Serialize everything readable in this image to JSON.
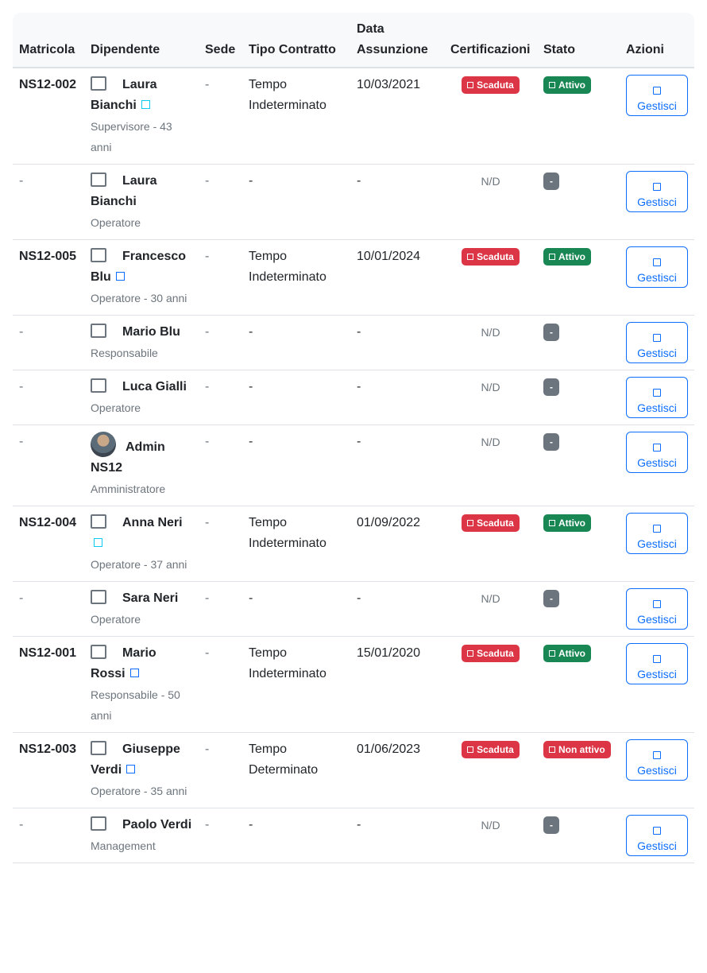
{
  "headers": {
    "matricola": "Matricola",
    "dipendente": "Dipendente",
    "sede": "Sede",
    "tipo_contratto": "Tipo Contratto",
    "data_assunzione": "Data Assunzione",
    "certificazioni": "Certificazioni",
    "stato": "Stato",
    "azioni": "Azioni"
  },
  "colors": {
    "danger": "#dc3545",
    "success": "#198754",
    "secondary": "#6c757d",
    "primary": "#0d6efd",
    "info": "#0dcaf0"
  },
  "rows": [
    {
      "matricola": "NS12-002",
      "first": "Laura",
      "last": "Bianchi",
      "mini": "info",
      "subtitle": "Supervisore - 43 anni",
      "sede": "-",
      "contratto": "Tempo Indeterminato",
      "data": "10/03/2021",
      "cert": "Scaduta",
      "stato": "Attivo",
      "stato_type": "success",
      "action": "Gestisci",
      "avatar": "checkbox-icon"
    },
    {
      "matricola": "-",
      "first": "Laura",
      "last": "Bianchi",
      "mini": "",
      "subtitle": "Operatore",
      "sede": "-",
      "contratto": "-",
      "data": "-",
      "cert": "N/D",
      "stato": "-",
      "stato_type": "secondary",
      "action": "Gestisci",
      "avatar": "checkbox-icon"
    },
    {
      "matricola": "NS12-005",
      "first": "Francesco",
      "last": "Blu",
      "mini": "blue",
      "subtitle": "Operatore - 30 anni",
      "sede": "-",
      "contratto": "Tempo Indeterminato",
      "data": "10/01/2024",
      "cert": "Scaduta",
      "stato": "Attivo",
      "stato_type": "success",
      "action": "Gestisci",
      "avatar": "checkbox-icon"
    },
    {
      "matricola": "-",
      "first": "Mario Blu",
      "last": "",
      "mini": "",
      "subtitle": "Responsabile",
      "sede": "-",
      "contratto": "-",
      "data": "-",
      "cert": "N/D",
      "stato": "-",
      "stato_type": "secondary",
      "action": "Gestisci",
      "avatar": "checkbox-icon"
    },
    {
      "matricola": "-",
      "first": "Luca Gialli",
      "last": "",
      "mini": "",
      "subtitle": "Operatore",
      "sede": "-",
      "contratto": "-",
      "data": "-",
      "cert": "N/D",
      "stato": "-",
      "stato_type": "secondary",
      "action": "Gestisci",
      "avatar": "checkbox-icon"
    },
    {
      "matricola": "-",
      "first": "Admin",
      "last": "NS12",
      "mini": "",
      "subtitle": "Amministratore",
      "sede": "-",
      "contratto": "-",
      "data": "-",
      "cert": "N/D",
      "stato": "-",
      "stato_type": "secondary",
      "action": "Gestisci",
      "avatar": "photo"
    },
    {
      "matricola": "NS12-004",
      "first": "Anna Neri",
      "last": "",
      "mini": "info-own-line",
      "subtitle": "Operatore - 37 anni",
      "sede": "-",
      "contratto": "Tempo Indeterminato",
      "data": "01/09/2022",
      "cert": "Scaduta",
      "stato": "Attivo",
      "stato_type": "success",
      "action": "Gestisci",
      "avatar": "checkbox-icon"
    },
    {
      "matricola": "-",
      "first": "Sara Neri",
      "last": "",
      "mini": "",
      "subtitle": "Operatore",
      "sede": "-",
      "contratto": "-",
      "data": "-",
      "cert": "N/D",
      "stato": "-",
      "stato_type": "secondary",
      "action": "Gestisci",
      "avatar": "checkbox-icon"
    },
    {
      "matricola": "NS12-001",
      "first": "Mario",
      "last": "Rossi",
      "mini": "blue",
      "subtitle": "Responsabile - 50 anni",
      "sede": "-",
      "contratto": "Tempo Indeterminato",
      "data": "15/01/2020",
      "cert": "Scaduta",
      "stato": "Attivo",
      "stato_type": "success",
      "action": "Gestisci",
      "avatar": "checkbox-icon"
    },
    {
      "matricola": "NS12-003",
      "first": "Giuseppe",
      "last": "Verdi",
      "mini": "blue",
      "subtitle": "Operatore - 35 anni",
      "sede": "-",
      "contratto": "Tempo Determinato",
      "data": "01/06/2023",
      "cert": "Scaduta",
      "stato": "Non attivo",
      "stato_type": "danger",
      "action": "Gestisci",
      "avatar": "checkbox-icon"
    },
    {
      "matricola": "-",
      "first": "Paolo",
      "last": "Verdi",
      "mini": "",
      "subtitle": "Management",
      "sede": "-",
      "contratto": "-",
      "data": "-",
      "cert": "N/D",
      "stato": "-",
      "stato_type": "secondary",
      "action": "Gestisci",
      "avatar": "checkbox-icon"
    }
  ]
}
